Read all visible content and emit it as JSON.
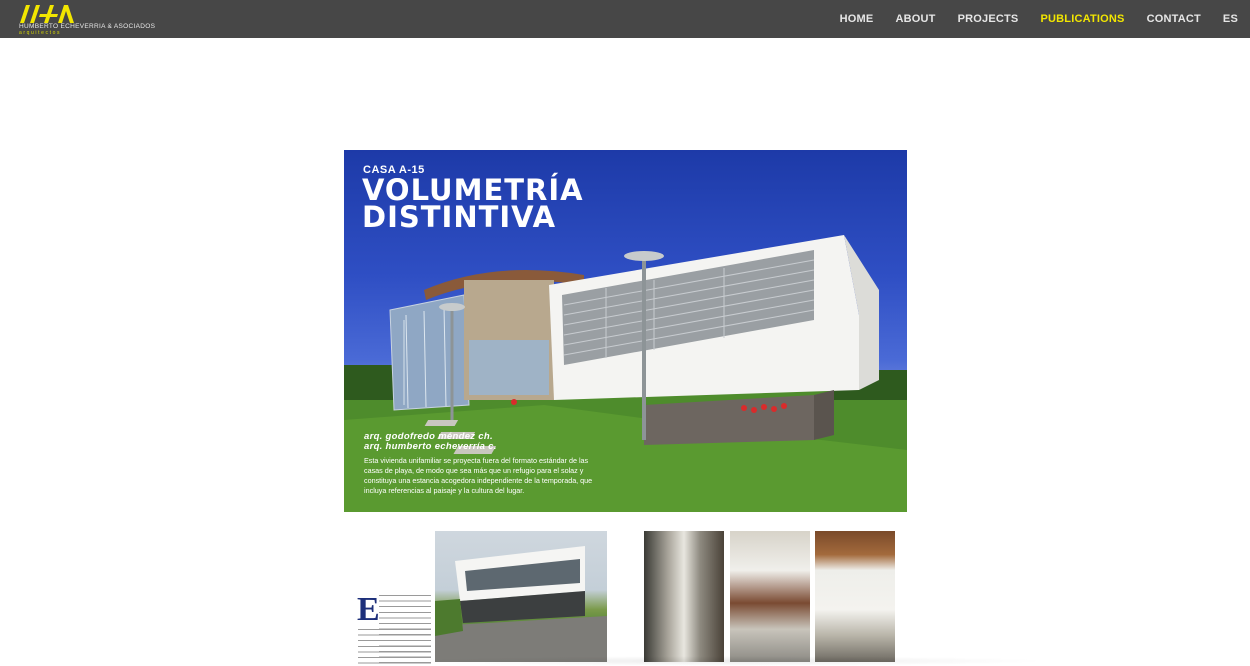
{
  "header": {
    "logo": {
      "name": "HUMBERTO ECHEVERRIA & ASOCIADOS",
      "sub": "arquitectos"
    },
    "nav": [
      {
        "label": "HOME",
        "active": false
      },
      {
        "label": "ABOUT",
        "active": false
      },
      {
        "label": "PROJECTS",
        "active": false
      },
      {
        "label": "PUBLICATIONS",
        "active": true
      },
      {
        "label": "CONTACT",
        "active": false
      },
      {
        "label": "ES",
        "active": false
      }
    ],
    "colors": {
      "bar": "#474747",
      "active": "#f2e600",
      "text": "#e6e6e6"
    }
  },
  "publication": {
    "kicker": "CASA A-15",
    "title_line1": "VOLUMETRÍA",
    "title_line2": "DISTINTIVA",
    "author1": "arq. godofredo méndez ch.",
    "author2": "arq. humberto echeverría c.",
    "body": "Esta vivienda unifamiliar se proyecta fuera del formato estándar de las casas de playa, de modo que sea más que un refugio para el solaz y constituya una estancia acogedora independiente de la temporada, que incluya referencias al paisaje y la cultura del lugar.",
    "dropcap": "E"
  }
}
